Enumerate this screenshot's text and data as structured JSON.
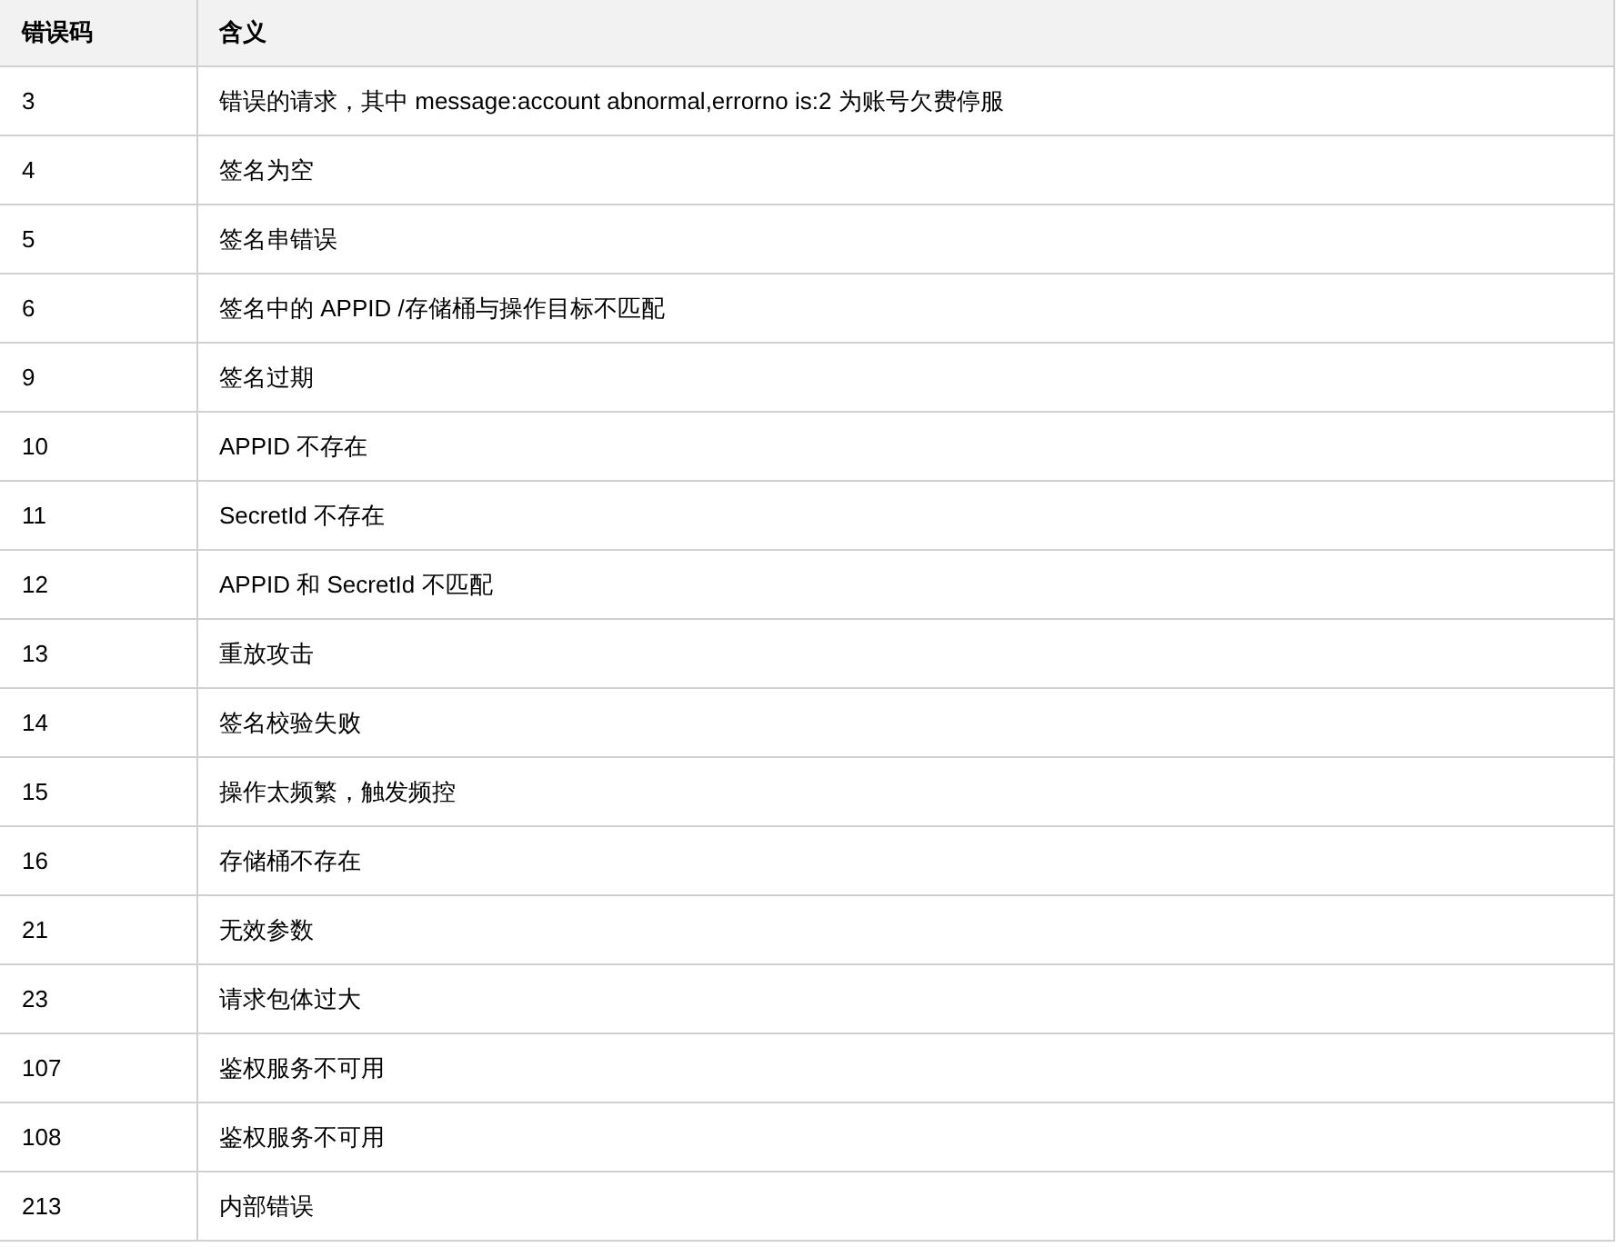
{
  "table": {
    "columns": [
      "错误码",
      "含义"
    ],
    "rows": [
      [
        "3",
        "错误的请求，其中 message:account abnormal,errorno is:2 为账号欠费停服"
      ],
      [
        "4",
        "签名为空"
      ],
      [
        "5",
        "签名串错误"
      ],
      [
        "6",
        "签名中的 APPID /存储桶与操作目标不匹配"
      ],
      [
        "9",
        "签名过期"
      ],
      [
        "10",
        "APPID 不存在"
      ],
      [
        "11",
        "SecretId 不存在"
      ],
      [
        "12",
        "APPID 和 SecretId 不匹配"
      ],
      [
        "13",
        "重放攻击"
      ],
      [
        "14",
        "签名校验失败"
      ],
      [
        "15",
        "操作太频繁，触发频控"
      ],
      [
        "16",
        "存储桶不存在"
      ],
      [
        "21",
        "无效参数"
      ],
      [
        "23",
        "请求包体过大"
      ],
      [
        "107",
        "鉴权服务不可用"
      ],
      [
        "108",
        "鉴权服务不可用"
      ],
      [
        "213",
        "内部错误"
      ]
    ]
  }
}
